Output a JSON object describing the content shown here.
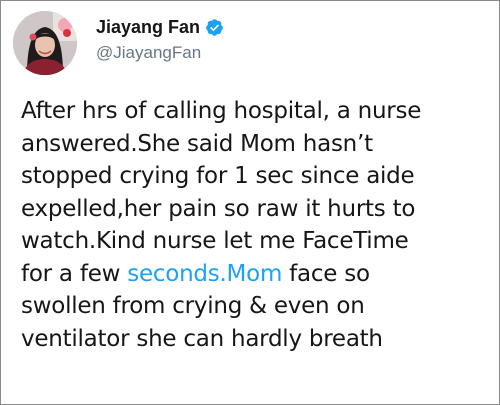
{
  "author": {
    "display_name": "Jiayang Fan",
    "handle": "@JiayangFan",
    "verified": true,
    "avatar_icon": "profile-photo",
    "verified_icon": "verified-badge-icon"
  },
  "tweet": {
    "lines": [
      "After hrs of calling hospital, a nurse",
      "answered.She said Mom hasn’t",
      "stopped crying for 1 sec since aide",
      "expelled,her pain so raw it hurts to",
      "watch.Kind nurse let me FaceTime"
    ],
    "line6_before": "for a few ",
    "link_text": "seconds.Mom",
    "line6_after": " face so",
    "lines_end": [
      "swollen from crying & even on",
      "ventilator she can hardly breath"
    ]
  },
  "colors": {
    "link": "#1da1f2",
    "verified": "#1da1f2",
    "text": "#14171a",
    "handle": "#657786"
  }
}
